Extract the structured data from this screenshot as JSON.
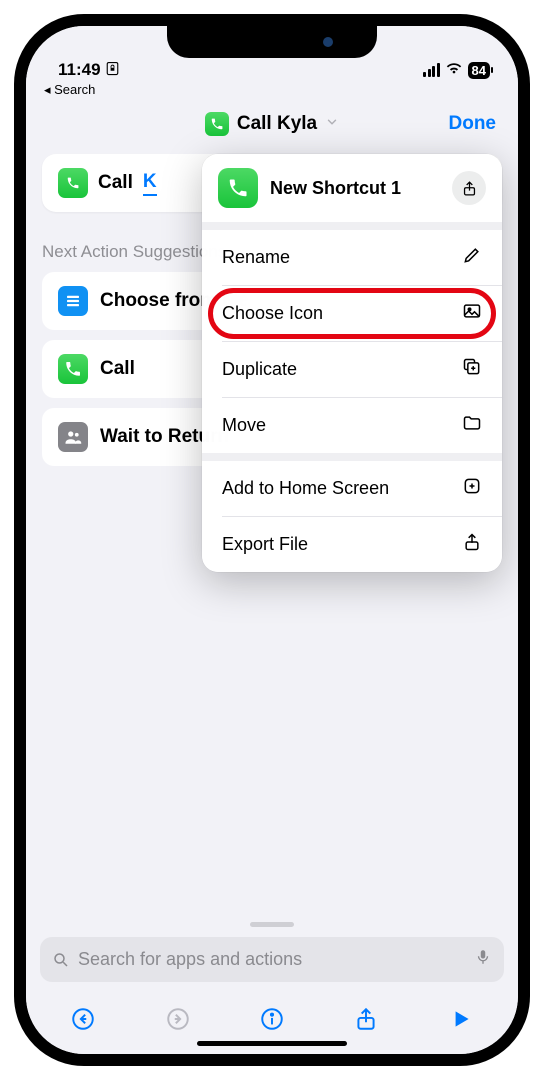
{
  "status": {
    "time": "11:49",
    "battery": "84"
  },
  "breadcrumb": "◂ Search",
  "header": {
    "title": "Call Kyla",
    "done": "Done"
  },
  "action": {
    "verb": "Call",
    "param": "K"
  },
  "section": "Next Action Suggestions",
  "suggestions": [
    {
      "label": "Choose from Menu"
    },
    {
      "label": "Call"
    },
    {
      "label": "Wait to Return"
    }
  ],
  "popover": {
    "title": "New Shortcut 1",
    "items": [
      {
        "label": "Rename",
        "icon": "pencil"
      },
      {
        "label": "Choose Icon",
        "icon": "photo",
        "highlight": true
      },
      {
        "label": "Duplicate",
        "icon": "plus-square"
      },
      {
        "label": "Move",
        "icon": "folder"
      },
      {
        "label": "Add to Home Screen",
        "icon": "plus-app"
      },
      {
        "label": "Export File",
        "icon": "export"
      }
    ]
  },
  "search": {
    "placeholder": "Search for apps and actions"
  }
}
